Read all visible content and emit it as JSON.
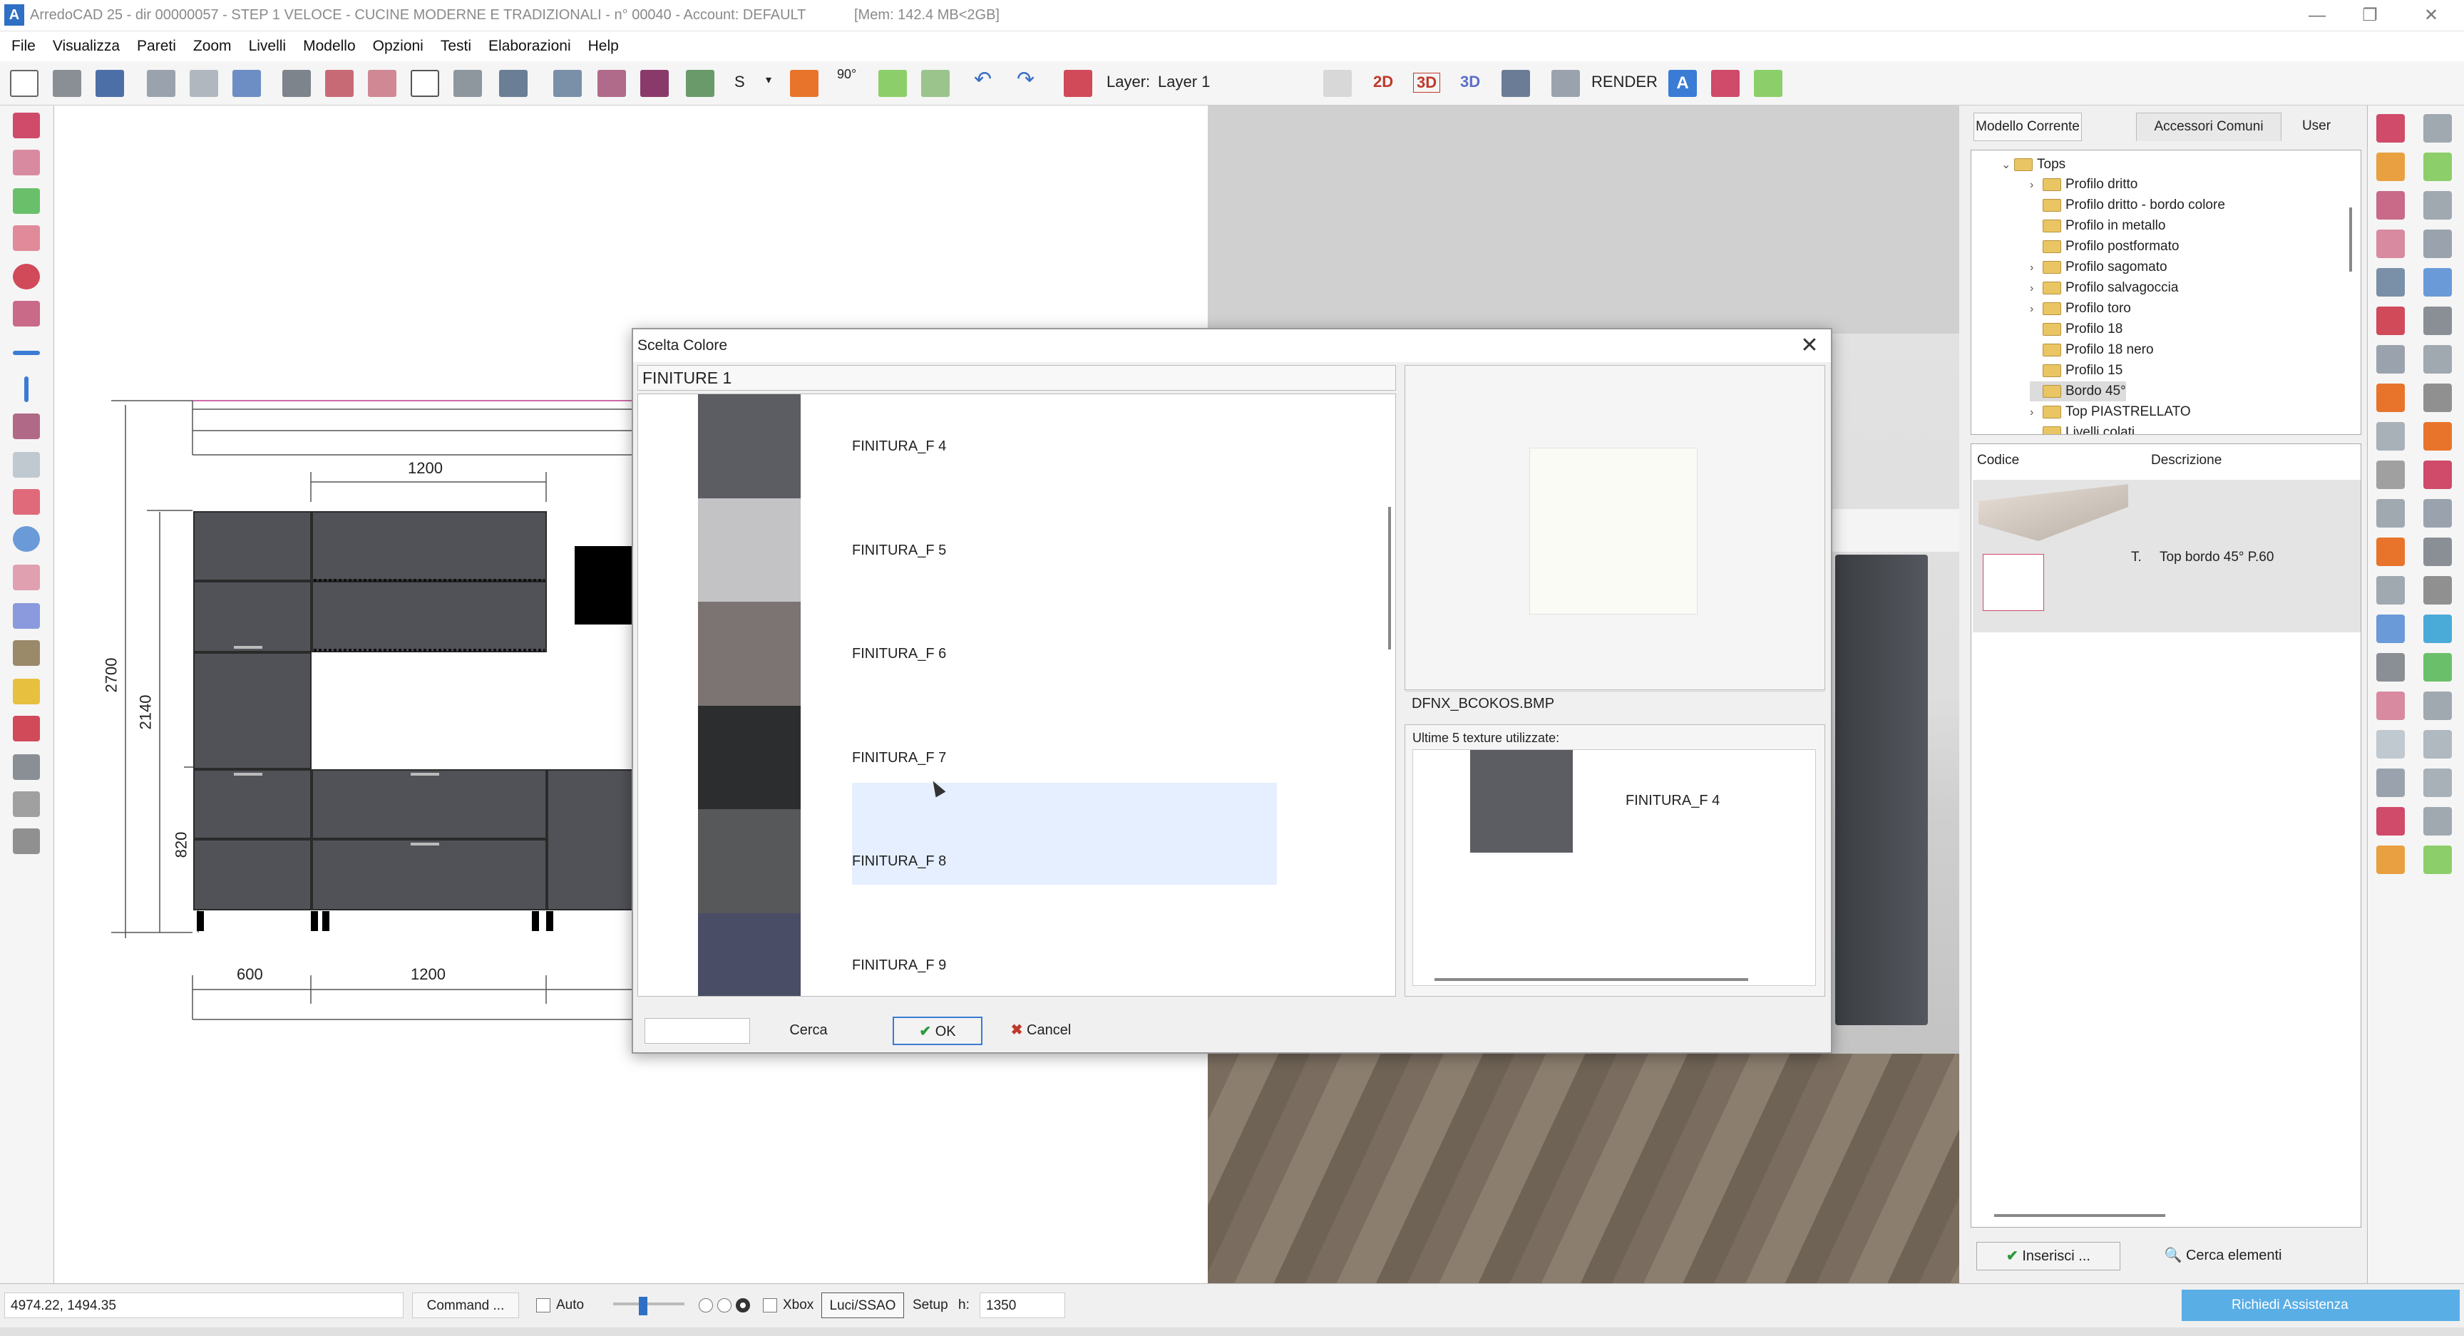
{
  "window": {
    "title": "ArredoCAD 25 - dir 00000057 - STEP 1 VELOCE - CUCINE MODERNE E TRADIZIONALI - n° 00040 - Account: DEFAULT",
    "memory": "[Mem: 142.4 MB<2GB]"
  },
  "menu": [
    "File",
    "Visualizza",
    "Pareti",
    "Zoom",
    "Livelli",
    "Modello",
    "Opzioni",
    "Testi",
    "Elaborazioni",
    "Help"
  ],
  "toolbar": {
    "s_label": "S",
    "angle_label": "90°",
    "layer_label": "Layer:",
    "layer_value": "Layer 1",
    "view_2d": "2D",
    "view_2d3d": "3D",
    "view_3d": "3D",
    "render_label": "RENDER",
    "text_a": "A"
  },
  "drawing": {
    "dims": {
      "top_width": "1200",
      "total_height": "2700",
      "height_2140": "2140",
      "height_820": "820",
      "bottom_600": "600",
      "bottom_1200": "1200"
    }
  },
  "dialog": {
    "title": "Scelta Colore",
    "list_header": "FINITURE 1",
    "finishes": [
      {
        "label": "FINITURA_F 4",
        "color": "#5b5d62"
      },
      {
        "label": "FINITURA_F 5",
        "color": "#c3c3c5"
      },
      {
        "label": "FINITURA_F 6",
        "color": "#7c7473"
      },
      {
        "label": "FINITURA_F 7",
        "color": "#2b2d2e"
      },
      {
        "label": "FINITURA_F 8",
        "color": "#57585a"
      },
      {
        "label": "FINITURA_F 9",
        "color": "#4a4d66"
      }
    ],
    "selected_index": 3,
    "texture_filename": "DFNX_BCOKOS.BMP",
    "recent_label": "Ultime 5 texture utilizzate:",
    "recent_items": [
      {
        "label": "FINITURA_F 4",
        "color": "#5b5d62"
      }
    ],
    "search_value": "",
    "search_button": "Cerca",
    "ok_button": "OK",
    "cancel_button": "Cancel"
  },
  "right_panel": {
    "tabs": [
      "Modello Corrente",
      "Accessori Comuni",
      "User"
    ],
    "active_tab": 1,
    "tree_root": "Tops",
    "tree_items": [
      {
        "label": "Profilo dritto",
        "expandable": true
      },
      {
        "label": "Profilo dritto - bordo colore",
        "expandable": false
      },
      {
        "label": "Profilo in metallo",
        "expandable": false
      },
      {
        "label": "Profilo postformato",
        "expandable": false
      },
      {
        "label": "Profilo sagomato",
        "expandable": true
      },
      {
        "label": "Profilo salvagoccia",
        "expandable": true
      },
      {
        "label": "Profilo toro",
        "expandable": true
      },
      {
        "label": "Profilo 18",
        "expandable": false
      },
      {
        "label": "Profilo 18 nero",
        "expandable": false
      },
      {
        "label": "Profilo 15",
        "expandable": false
      },
      {
        "label": "Bordo 45°",
        "expandable": false,
        "selected": true
      },
      {
        "label": "Top PIASTRELLATO",
        "expandable": true
      },
      {
        "label": "Livelli colati",
        "expandable": false
      }
    ],
    "col_code": "Codice",
    "col_desc": "Descrizione",
    "row_code": "T.",
    "row_desc": "Top bordo 45° P.60",
    "insert_button": "Inserisci ...",
    "search_button": "Cerca elementi"
  },
  "statusbar": {
    "coords": "4974.22, 1494.35",
    "command": "Command ...",
    "auto_label": "Auto",
    "xbox_label": "Xbox",
    "luci_label": "Luci/SSAO",
    "setup_label": "Setup",
    "h_label": "h:",
    "h_value": "1350",
    "assist_button": "Richiedi Assistenza"
  },
  "colors": {
    "accent": "#3a7bd5",
    "cabinet": "#505257",
    "assist_bg": "#5aaee6"
  }
}
